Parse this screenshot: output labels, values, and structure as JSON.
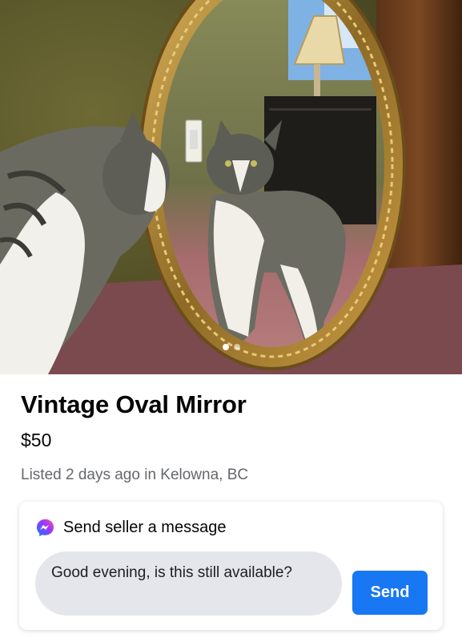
{
  "listing": {
    "title": "Vintage Oval Mirror",
    "price": "$50",
    "meta": "Listed 2 days ago in Kelowna, BC"
  },
  "gallery": {
    "image_count": 2,
    "active_index": 0
  },
  "message_card": {
    "header_icon": "messenger-icon",
    "header_label": "Send seller a message",
    "message_text": "Good evening, is this still available?",
    "send_label": "Send"
  },
  "colors": {
    "accent": "#1877f2",
    "text_primary": "#050505",
    "text_secondary": "#65676b",
    "input_bg": "#e4e6eb"
  }
}
